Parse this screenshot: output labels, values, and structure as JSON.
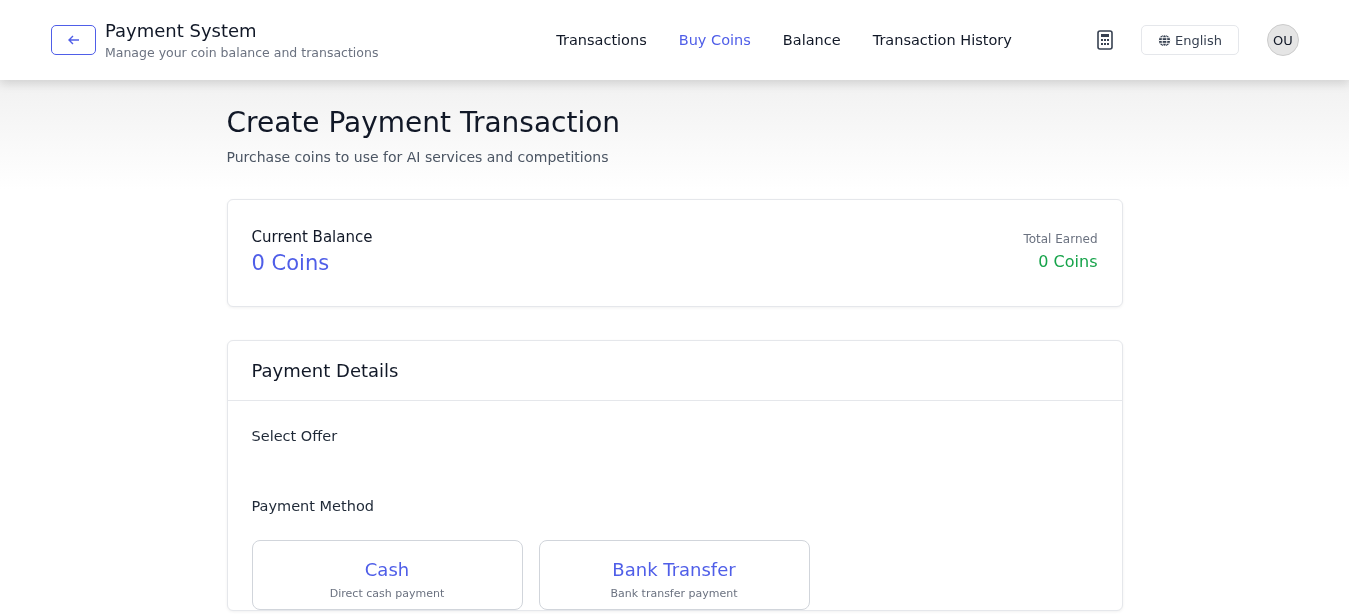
{
  "header": {
    "title": "Payment System",
    "subtitle": "Manage your coin balance and transactions"
  },
  "nav": [
    {
      "label": "Transactions",
      "selected": false
    },
    {
      "label": "Buy Coins",
      "selected": true
    },
    {
      "label": "Balance",
      "selected": false
    },
    {
      "label": "Transaction History",
      "selected": false
    }
  ],
  "language": "English",
  "avatar": "OU",
  "page": {
    "title": "Create Payment Transaction",
    "subtitle": "Purchase coins to use for AI services and competitions"
  },
  "balance": {
    "label": "Current Balance",
    "value": "0 Coins",
    "earned_label": "Total Earned",
    "earned_value": "0 Coins"
  },
  "details": {
    "title": "Payment Details",
    "offer_label": "Select Offer",
    "method_label": "Payment Method",
    "methods": [
      {
        "name": "Cash",
        "description": "Direct cash payment"
      },
      {
        "name": "Bank Transfer",
        "description": "Bank transfer payment"
      }
    ]
  }
}
